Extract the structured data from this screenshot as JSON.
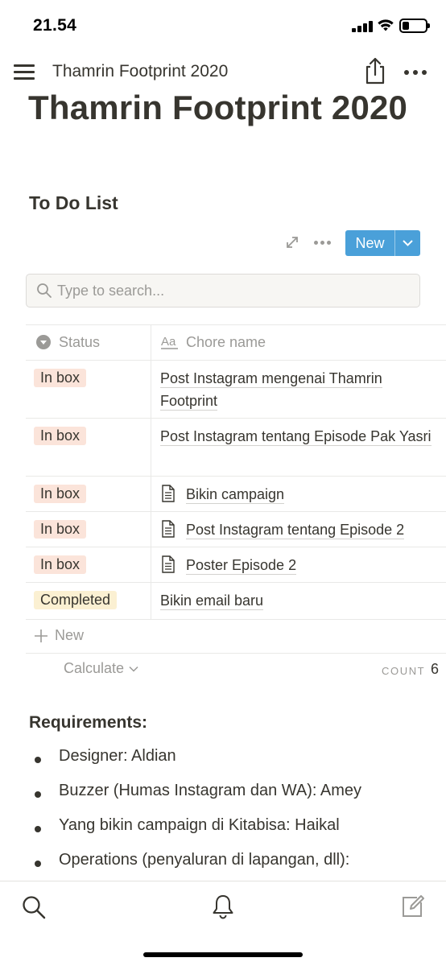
{
  "status_bar": {
    "time": "21.54",
    "battery_level": 0.3
  },
  "topbar": {
    "title": "Thamrin Footprint 2020",
    "icons": [
      "menu-icon",
      "share-icon",
      "more-icon"
    ]
  },
  "page": {
    "title": "Thamrin Footprint 2020"
  },
  "todo": {
    "section_title": "To Do List",
    "new_button_label": "New",
    "search_placeholder": "Type to search...",
    "columns": {
      "status": "Status",
      "name": "Chore name"
    },
    "rows": [
      {
        "status": "In box",
        "name": "Post Instagram mengenai Thamrin Footprint",
        "icon": ""
      },
      {
        "status": "In box",
        "name": "Post Instagram tentang Episode Pak Yasri",
        "icon": ""
      },
      {
        "status": "In box",
        "name": "Bikin campaign",
        "icon": "document-icon"
      },
      {
        "status": "In box",
        "name": "Post Instagram tentang Episode 2",
        "icon": "document-icon"
      },
      {
        "status": "In box",
        "name": "Poster Episode 2",
        "icon": "document-icon"
      },
      {
        "status": "Completed",
        "name": "Bikin email baru",
        "icon": ""
      }
    ],
    "new_row_label": "New",
    "calculate_label": "Calculate",
    "count_label": "COUNT",
    "count_value": "6"
  },
  "requirements": {
    "title": "Requirements:",
    "items": [
      "Designer: Aldian",
      "Buzzer (Humas Instagram dan WA): Amey",
      "Yang bikin campaign di Kitabisa: Haikal",
      "Operations (penyaluran di lapangan, dll):"
    ]
  },
  "colors": {
    "accent": "#4aa0d9",
    "tag_inbox": "#fbe4da",
    "tag_completed": "#fbf0d2",
    "text": "#37352f",
    "muted": "#9b9a97"
  }
}
